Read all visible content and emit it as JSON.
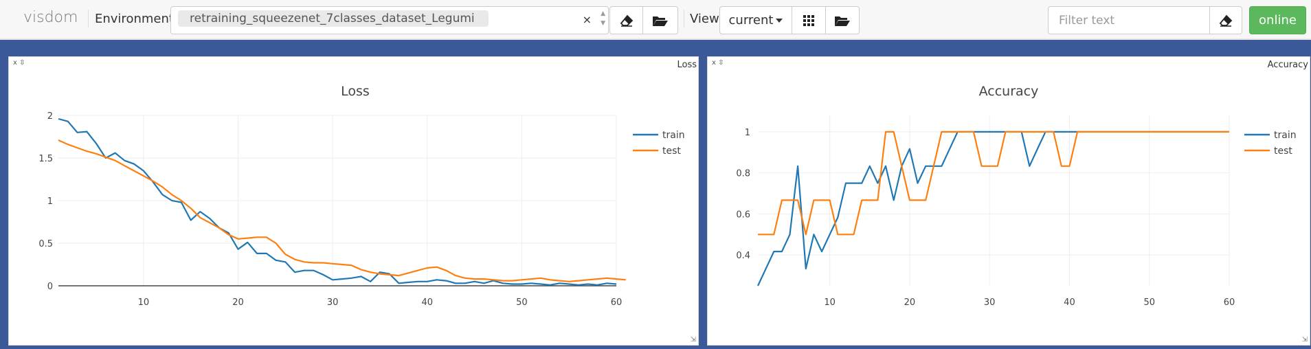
{
  "topbar": {
    "brand": "visdom",
    "env_label": "Environment",
    "env_value": "retraining_squeezenet_7classes_dataset_Legumi",
    "clear_glyph": "×",
    "view_label": "View",
    "view_value": "current",
    "filter_placeholder": "Filter text",
    "status": "online",
    "status_color": "#5cb85c",
    "icons": [
      "eraser-icon",
      "folder-open-icon",
      "grid-icon",
      "folder-open-icon",
      "eraser-icon"
    ]
  },
  "panes": [
    {
      "window_title": "Loss",
      "controls": "x ⇳",
      "chart_data": {
        "type": "line",
        "title": "Loss",
        "xlim": [
          1,
          60
        ],
        "ylim": [
          0,
          2
        ],
        "x_ticks": [
          10,
          20,
          30,
          40,
          50,
          60
        ],
        "y_ticks": [
          0,
          0.5,
          1,
          1.5,
          2
        ],
        "legend_position": "top-right",
        "grid": true,
        "series": [
          {
            "name": "train",
            "color": "#1f77b4",
            "values": [
              1.96,
              1.93,
              1.8,
              1.81,
              1.67,
              1.5,
              1.56,
              1.47,
              1.43,
              1.35,
              1.22,
              1.07,
              1.0,
              0.98,
              0.77,
              0.87,
              0.79,
              0.68,
              0.62,
              0.43,
              0.51,
              0.38,
              0.38,
              0.3,
              0.28,
              0.16,
              0.18,
              0.18,
              0.13,
              0.07,
              0.08,
              0.09,
              0.11,
              0.05,
              0.16,
              0.14,
              0.03,
              0.04,
              0.05,
              0.05,
              0.07,
              0.06,
              0.03,
              0.03,
              0.05,
              0.03,
              0.06,
              0.03,
              0.02,
              0.02,
              0.03,
              0.02,
              0.01,
              0.03,
              0.02,
              0.01,
              0.02,
              0.01,
              0.03,
              0.02
            ]
          },
          {
            "name": "test",
            "color": "#ff7f0e",
            "values": [
              1.71,
              1.66,
              1.62,
              1.58,
              1.55,
              1.51,
              1.47,
              1.41,
              1.35,
              1.29,
              1.23,
              1.16,
              1.07,
              1.0,
              0.91,
              0.8,
              0.74,
              0.68,
              0.6,
              0.55,
              0.56,
              0.57,
              0.57,
              0.5,
              0.37,
              0.31,
              0.28,
              0.27,
              0.27,
              0.26,
              0.25,
              0.24,
              0.19,
              0.16,
              0.14,
              0.13,
              0.12,
              0.15,
              0.18,
              0.21,
              0.22,
              0.18,
              0.12,
              0.09,
              0.08,
              0.08,
              0.07,
              0.06,
              0.06,
              0.07,
              0.08,
              0.09,
              0.07,
              0.06,
              0.05,
              0.06,
              0.07,
              0.08,
              0.09,
              0.08,
              0.07
            ]
          }
        ]
      }
    },
    {
      "window_title": "Accuracy",
      "controls": "x ⇳",
      "chart_data": {
        "type": "line",
        "title": "Accuracy",
        "xlim": [
          1,
          60
        ],
        "ylim": [
          0.25,
          1.08
        ],
        "x_ticks": [
          10,
          20,
          30,
          40,
          50,
          60
        ],
        "y_ticks": [
          0.4,
          0.6,
          0.8,
          1
        ],
        "legend_position": "top-right",
        "grid": true,
        "series": [
          {
            "name": "train",
            "color": "#1f77b4",
            "values": [
              0.25,
              0.333,
              0.417,
              0.417,
              0.5,
              0.833,
              0.333,
              0.5,
              0.417,
              0.5,
              0.583,
              0.75,
              0.75,
              0.75,
              0.833,
              0.75,
              0.833,
              0.667,
              0.833,
              0.917,
              0.75,
              0.833,
              0.833,
              0.833,
              0.917,
              1,
              1,
              1,
              1,
              1,
              1,
              1,
              1,
              1,
              0.833,
              0.917,
              1,
              1,
              1,
              1,
              1,
              1,
              1,
              1,
              1,
              1,
              1,
              1,
              1,
              1,
              1,
              1,
              1,
              1,
              1,
              1,
              1,
              1,
              1,
              1
            ]
          },
          {
            "name": "test",
            "color": "#ff7f0e",
            "values": [
              0.5,
              0.5,
              0.5,
              0.667,
              0.667,
              0.667,
              0.5,
              0.667,
              0.667,
              0.667,
              0.5,
              0.5,
              0.5,
              0.667,
              0.667,
              0.667,
              1,
              1,
              0.833,
              0.667,
              0.667,
              0.667,
              0.833,
              1,
              1,
              1,
              1,
              1,
              0.833,
              0.833,
              0.833,
              1,
              1,
              1,
              1,
              1,
              1,
              1,
              0.833,
              0.833,
              1,
              1,
              1,
              1,
              1,
              1,
              1,
              1,
              1,
              1,
              1,
              1,
              1,
              1,
              1,
              1,
              1,
              1,
              1,
              1
            ]
          }
        ]
      }
    }
  ]
}
